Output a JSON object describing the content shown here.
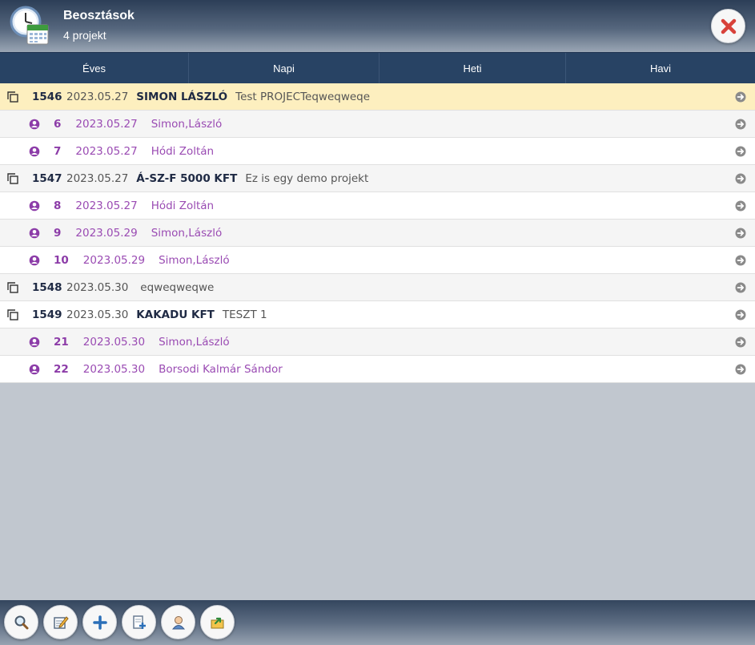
{
  "header": {
    "title": "Beosztások",
    "subtitle": "4 projekt",
    "app_icon": "clock-calendar-icon",
    "close_icon": "close-icon"
  },
  "tabs": [
    {
      "label": "Éves"
    },
    {
      "label": "Napi"
    },
    {
      "label": "Heti"
    },
    {
      "label": "Havi"
    }
  ],
  "rows": [
    {
      "type": "project",
      "id": "1546",
      "date": "2023.05.27",
      "client": "SIMON LÁSZLÓ",
      "description": "Test PROJECTeqweqweqe",
      "highlight": true
    },
    {
      "type": "person",
      "id": "6",
      "date": "2023.05.27",
      "name": "Simon,László"
    },
    {
      "type": "person",
      "id": "7",
      "date": "2023.05.27",
      "name": "Hódi Zoltán"
    },
    {
      "type": "project",
      "id": "1547",
      "date": "2023.05.27",
      "client": "Á-SZ-F 5000 KFT",
      "description": "Ez is egy demo projekt"
    },
    {
      "type": "person",
      "id": "8",
      "date": "2023.05.27",
      "name": "Hódi Zoltán"
    },
    {
      "type": "person",
      "id": "9",
      "date": "2023.05.29",
      "name": "Simon,László"
    },
    {
      "type": "person",
      "id": "10",
      "date": "2023.05.29",
      "name": "Simon,László"
    },
    {
      "type": "project",
      "id": "1548",
      "date": "2023.05.30",
      "client": "",
      "description": "eqweqweqwe"
    },
    {
      "type": "project",
      "id": "1549",
      "date": "2023.05.30",
      "client": "KAKADU KFT",
      "description": "TESZT 1"
    },
    {
      "type": "person",
      "id": "21",
      "date": "2023.05.30",
      "name": "Simon,László"
    },
    {
      "type": "person",
      "id": "22",
      "date": "2023.05.30",
      "name": "Borsodi Kalmár Sándor"
    }
  ],
  "toolbar": [
    {
      "name": "search-button",
      "icon": "magnifier-icon"
    },
    {
      "name": "edit-button",
      "icon": "edit-note-icon"
    },
    {
      "name": "add-button",
      "icon": "plus-icon"
    },
    {
      "name": "add-document-button",
      "icon": "document-add-icon"
    },
    {
      "name": "user-button",
      "icon": "user-icon"
    },
    {
      "name": "export-button",
      "icon": "export-icon"
    }
  ],
  "colors": {
    "header_dark": "#2c3e57",
    "tab_bar": "#284364",
    "highlight_row": "#fdefbf",
    "person_text": "#9a4bb3",
    "project_text": "#1f2a44",
    "close_red": "#d8413a",
    "background": "#c1c7cf"
  }
}
